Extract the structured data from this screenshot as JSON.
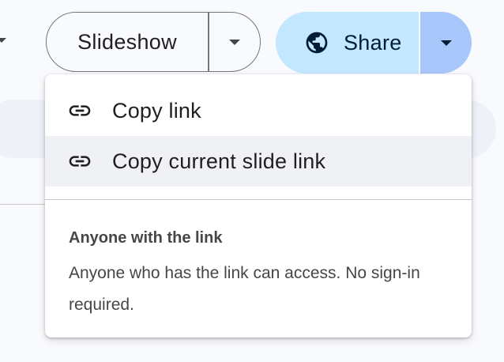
{
  "toolbar": {
    "slideshow_label": "Slideshow",
    "share_label": "Share",
    "share_icon": "globe-icon",
    "colors": {
      "share_bg": "#c2e7ff",
      "share_drop_bg": "#a8c7fa",
      "outline": "#747775"
    }
  },
  "share_menu": {
    "items": [
      {
        "label": "Copy link",
        "icon": "link-icon"
      },
      {
        "label": "Copy current slide link",
        "icon": "link-icon"
      }
    ],
    "access": {
      "title": "Anyone with the link",
      "description": "Anyone who has the link can access. No sign-in required."
    }
  }
}
